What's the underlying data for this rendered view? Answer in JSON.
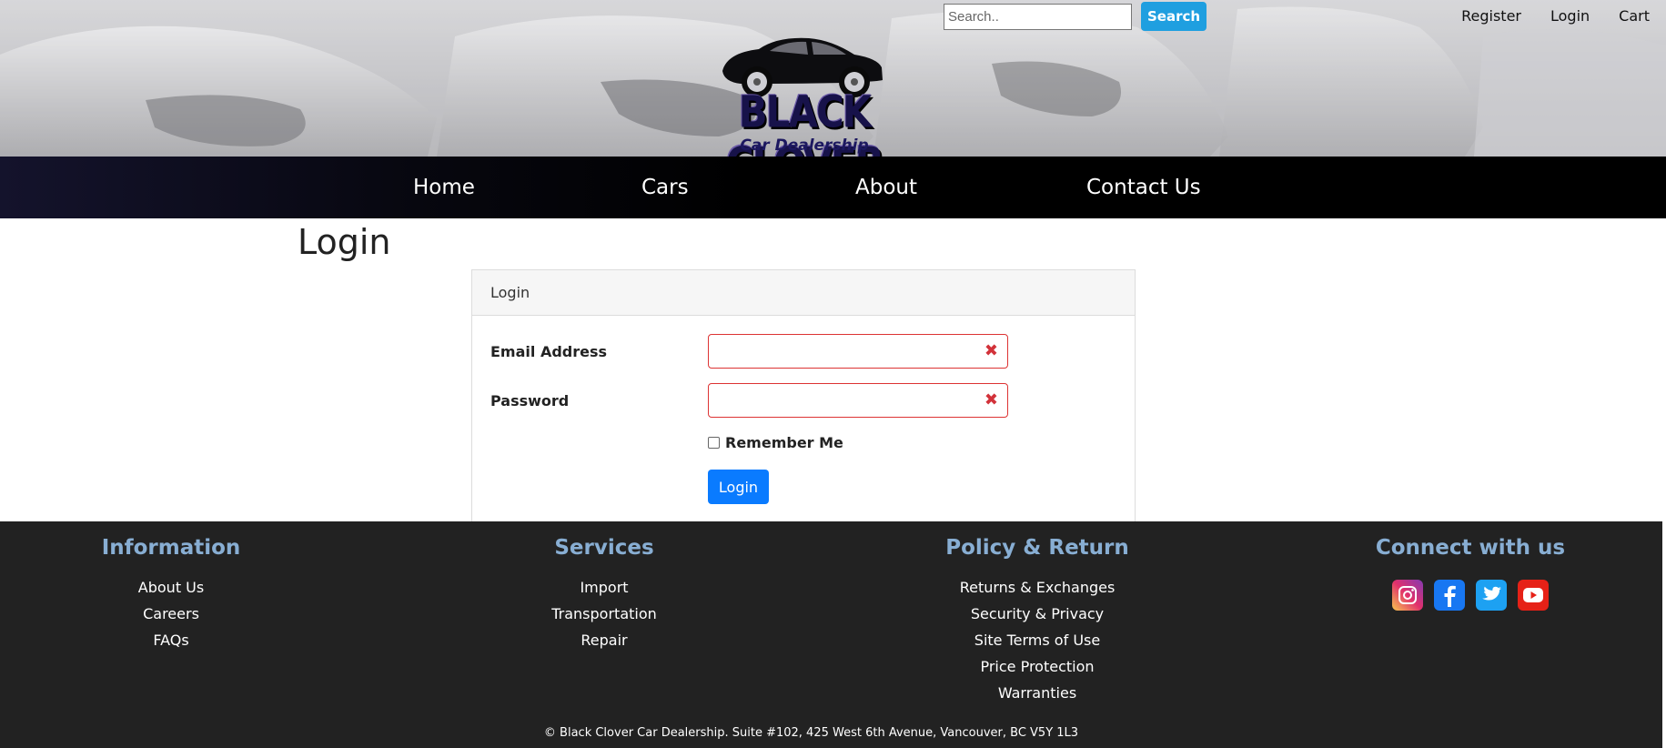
{
  "header": {
    "search": {
      "placeholder": "Search..",
      "button_label": "Search"
    },
    "top_links": [
      "Register",
      "Login",
      "Cart"
    ],
    "logo": {
      "title": "BLACK CLOVER",
      "subtitle": "Car Dealership"
    }
  },
  "nav": {
    "items": [
      "Home",
      "Cars",
      "About",
      "Contact Us"
    ]
  },
  "main": {
    "page_title": "Login",
    "card": {
      "header": "Login",
      "email_label": "Email Address",
      "email_value": "",
      "password_label": "Password",
      "password_value": "",
      "remember_label": "Remember Me",
      "remember_checked": false,
      "submit_label": "Login",
      "error_icon": "✖"
    }
  },
  "footer": {
    "columns": [
      {
        "title": "Information",
        "links": [
          "About Us",
          "Careers",
          "FAQs"
        ]
      },
      {
        "title": "Services",
        "links": [
          "Import",
          "Transportation",
          "Repair"
        ]
      },
      {
        "title": "Policy & Return",
        "links": [
          "Returns & Exchanges",
          "Security & Privacy",
          "Site Terms of Use",
          "Price Protection",
          "Warranties"
        ]
      },
      {
        "title": "Connect with us",
        "social": [
          "instagram-icon",
          "facebook-icon",
          "twitter-icon",
          "youtube-icon"
        ]
      }
    ],
    "copyright": "© Black Clover Car Dealership. Suite #102, 425 West 6th Avenue, Vancouver, BC V5Y 1L3"
  },
  "colors": {
    "nav_bg": "#000000",
    "footer_bg": "#222222",
    "footer_heading": "#88aed3",
    "primary_button": "#0a7bff",
    "search_button": "#1f9fe0",
    "error": "#d2323a"
  }
}
